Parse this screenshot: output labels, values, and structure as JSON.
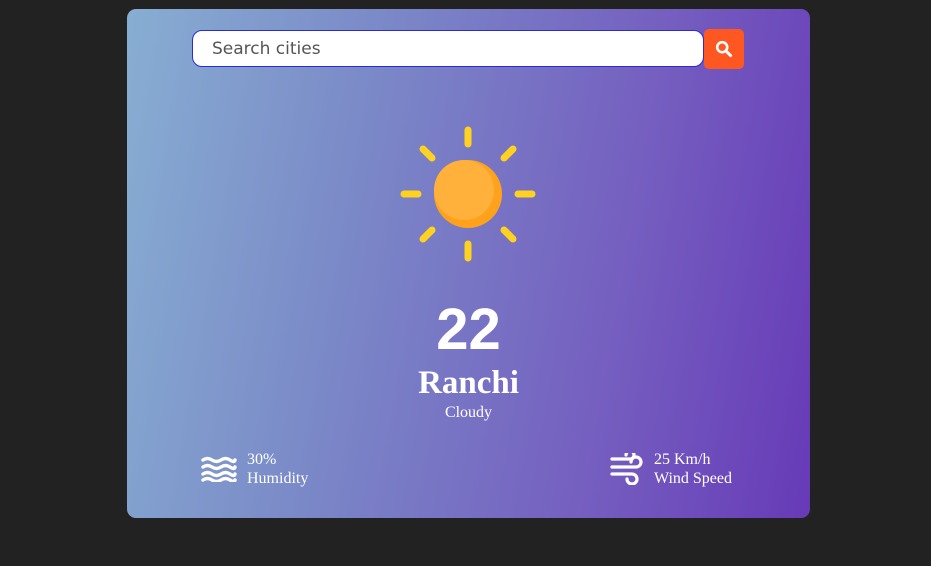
{
  "search": {
    "placeholder": "Search cities",
    "value": ""
  },
  "weather": {
    "icon": "sun-icon",
    "temperature": "22",
    "city": "Ranchi",
    "description": "Cloudy"
  },
  "humidity": {
    "value": "30%",
    "label": "Humidity",
    "icon": "waves-icon"
  },
  "wind": {
    "value": "25 Km/h",
    "label": "Wind Speed",
    "icon": "wind-icon"
  },
  "colors": {
    "background": "#222222",
    "search_button": "#ff5722",
    "sun": "#ffb13b",
    "sun_rays": "#ffd21f",
    "gradient_start": "#87aed2",
    "gradient_end": "#673ab7"
  }
}
